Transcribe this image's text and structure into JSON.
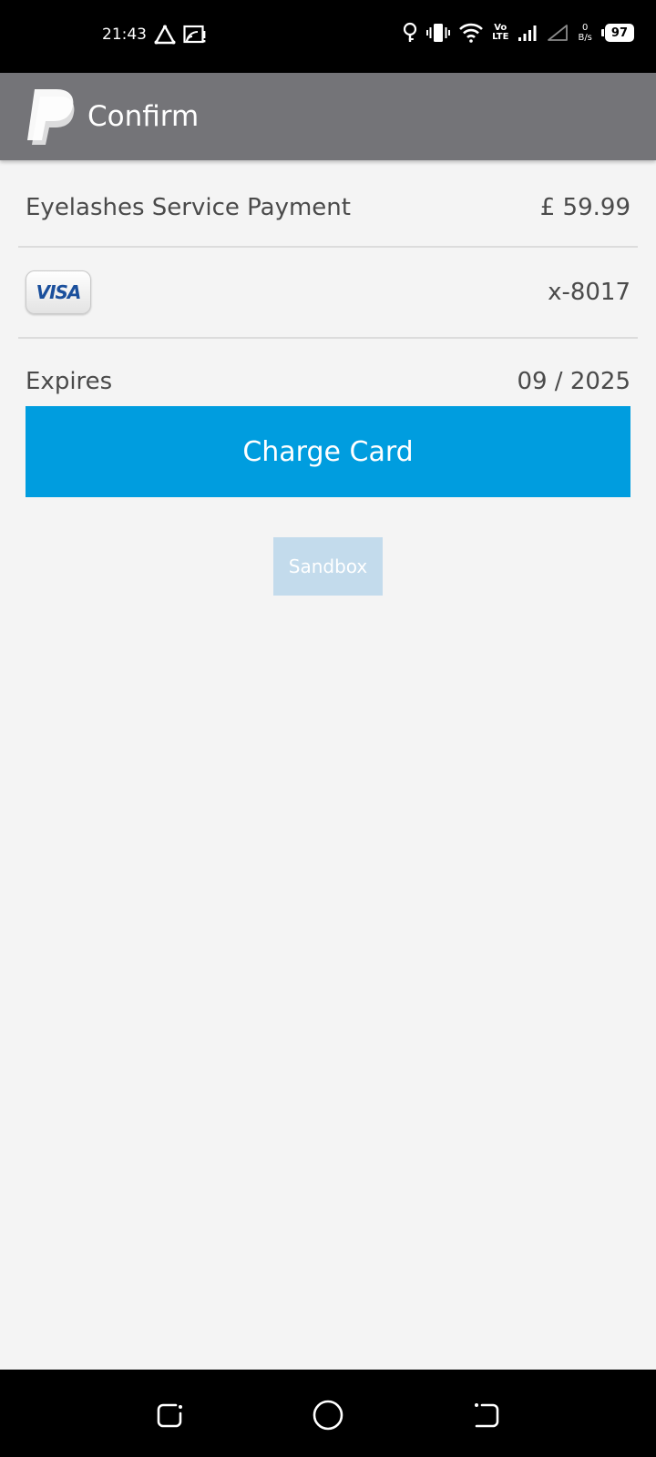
{
  "status_bar": {
    "time": "21:43",
    "battery_level": "97",
    "net_speed_value": "0",
    "net_speed_unit": "B/s",
    "volte_top": "Vo",
    "volte_bottom": "LTE"
  },
  "app_bar": {
    "title": "Confirm"
  },
  "payment": {
    "description": "Eyelashes Service Payment",
    "amount": "£ 59.99",
    "card_brand": "VISA",
    "card_masked_number": "x-8017",
    "expires_label": "Expires",
    "expires_value": "09 / 2025"
  },
  "actions": {
    "charge_label": "Charge Card",
    "sandbox_label": "Sandbox"
  },
  "colors": {
    "app_bar": "#747478",
    "charge_button": "#009ddf",
    "sandbox_badge": "#c3dbec",
    "background": "#f4f4f4"
  },
  "icons": {
    "status_left": [
      "alert-triangle-icon",
      "screencast-warning-icon"
    ],
    "status_right": [
      "bulb-icon",
      "vibrate-icon",
      "wifi-icon",
      "volte-icon",
      "signal-icon",
      "no-signal-icon",
      "net-speed-indicator",
      "battery-icon"
    ],
    "navigation": [
      "recents-icon",
      "home-icon",
      "back-icon"
    ]
  }
}
